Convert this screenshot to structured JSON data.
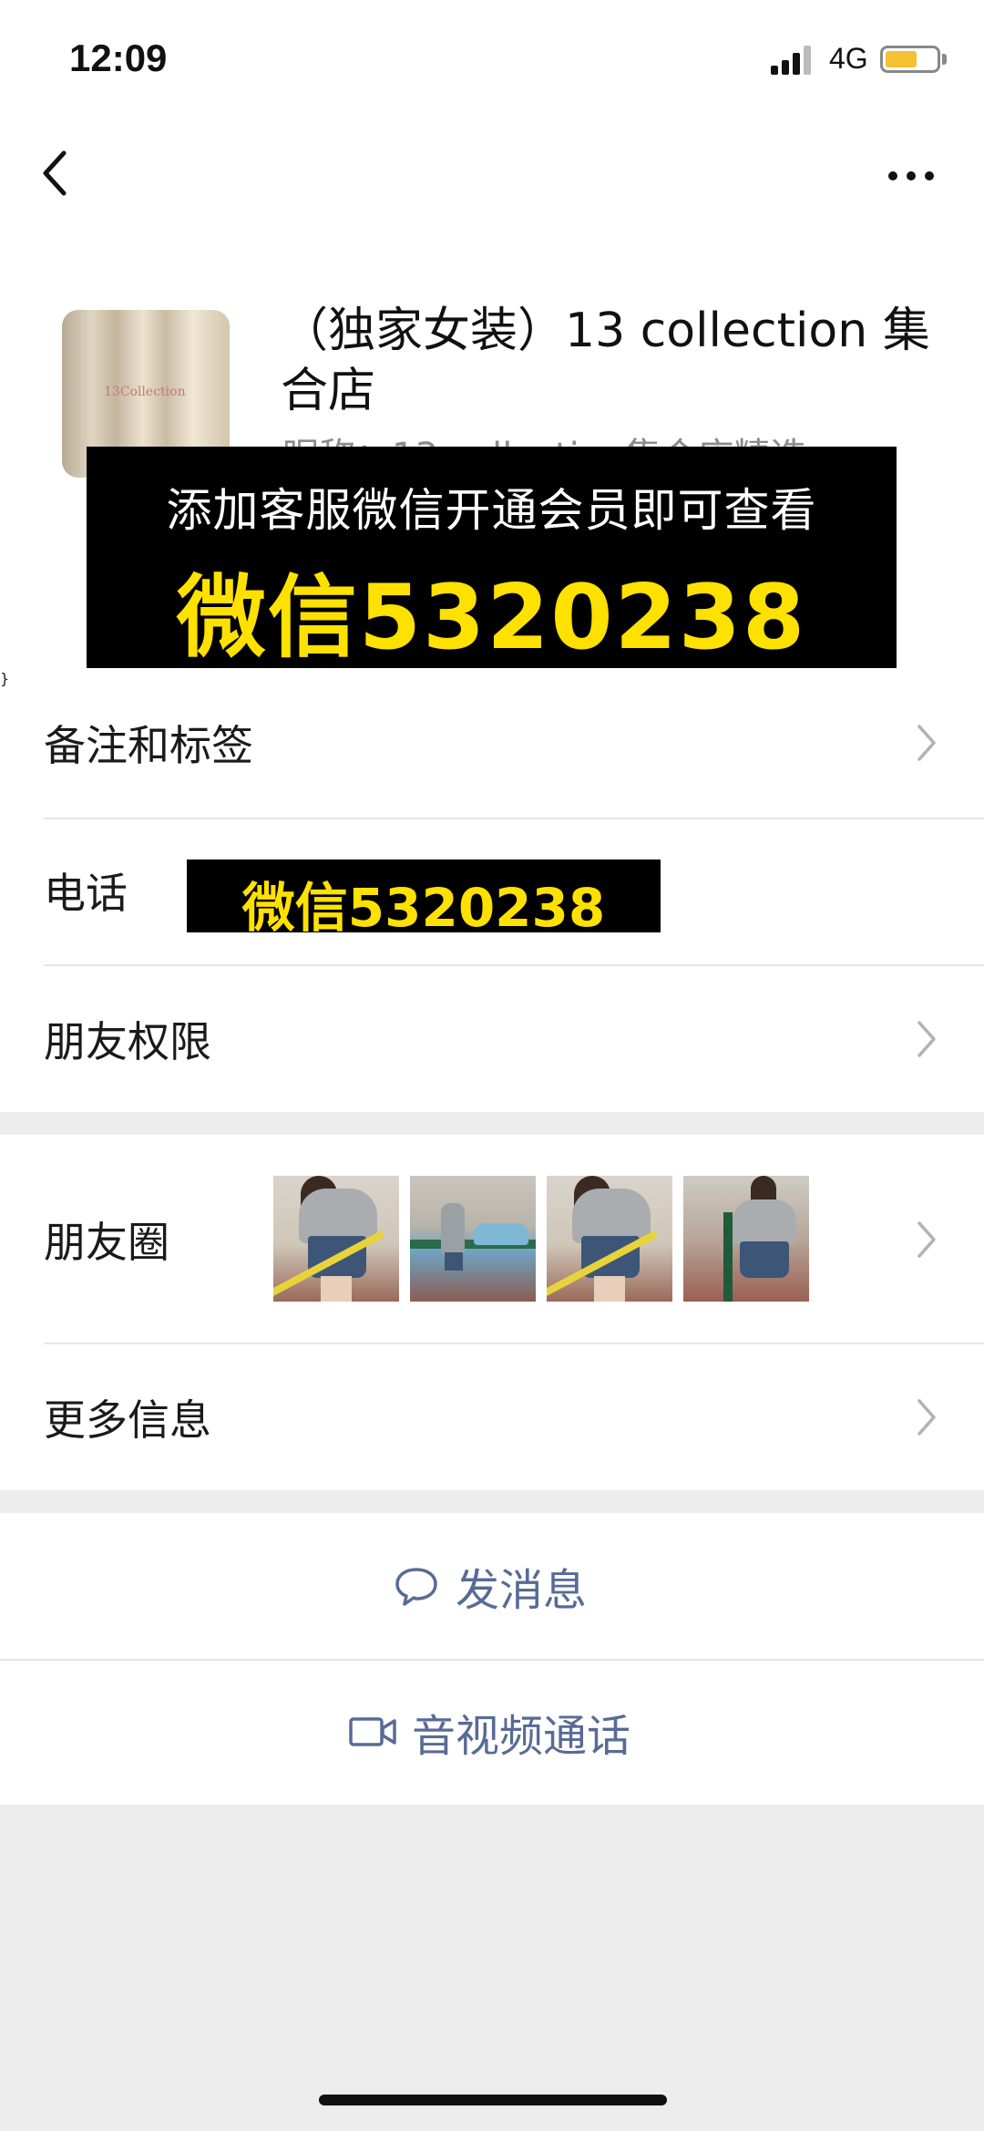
{
  "status_bar": {
    "time": "12:09",
    "network": "4G"
  },
  "profile": {
    "name": "（独家女装）13 collection 集合店",
    "alias_partial": "昵称：13 collection集合店精选",
    "avatar_watermark": "13Collection"
  },
  "promo": {
    "headline": "添加客服微信开通会员即可查看",
    "wechat": "微信5320238"
  },
  "info_rows": {
    "remarks_label": "备注和标签",
    "phone_label": "电话",
    "phone_value": "微信5320238",
    "permissions_label": "朋友权限"
  },
  "moments": {
    "label": "朋友圈",
    "thumbnails": [
      "photo-1",
      "photo-2",
      "photo-3",
      "photo-4"
    ]
  },
  "more_info": {
    "label": "更多信息"
  },
  "actions": {
    "message_label": "发消息",
    "call_label": "音视频通话"
  },
  "colors": {
    "link_blue": "#576b95",
    "promo_yellow": "#ffe100",
    "battery_yellow": "#f2c230"
  },
  "icons": [
    "back-icon",
    "more-icon",
    "chevron-right-icon",
    "chat-bubble-icon",
    "video-camera-icon"
  ]
}
